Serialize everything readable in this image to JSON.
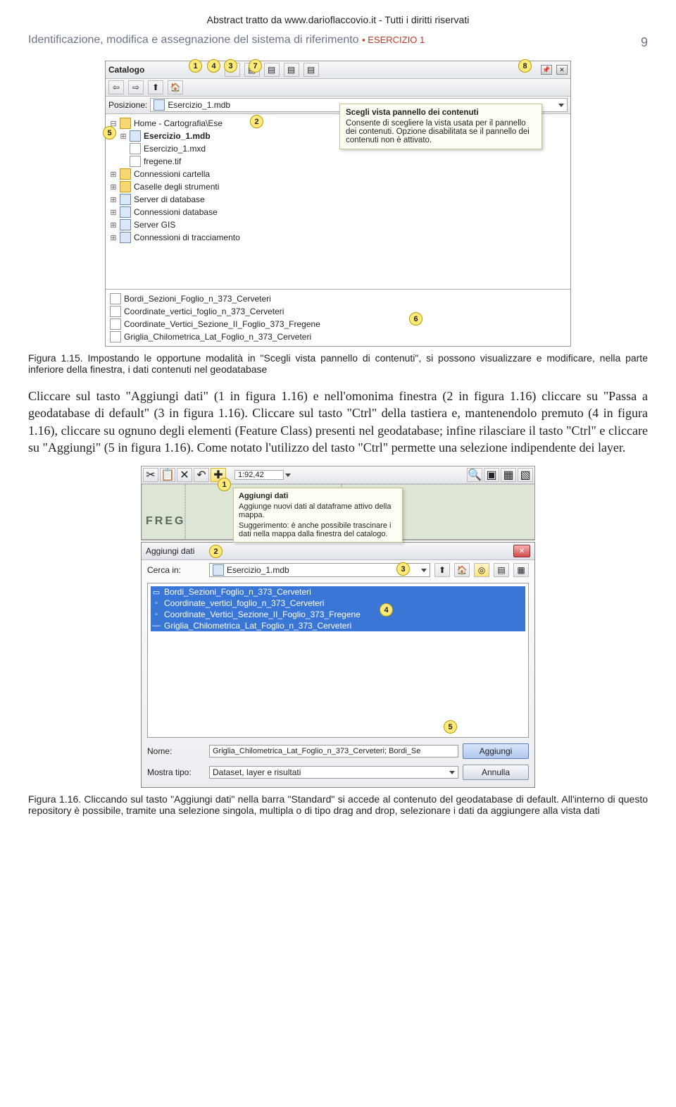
{
  "header": {
    "source_line": "Abstract tratto da www.darioflaccovio.it - Tutti i diritti riservati",
    "section": "Identificazione, modifica e assegnazione del sistema di riferimento",
    "exercise": "ESERCIZIO 1",
    "page_number": "9"
  },
  "screenshot1": {
    "title": "Catalogo",
    "position_label": "Posizione:",
    "position_value": "Esercizio_1.mdb",
    "tooltip_title": "Scegli vista pannello dei contenuti",
    "tooltip_body": "Consente di scegliere la vista usata per il pannello dei contenuti. Opzione disabilitata se il pannello dei contenuti non è attivato.",
    "tree": [
      "Home - Cartografia\\Ese",
      "Esercizio_1.mdb",
      "Esercizio_1.mxd",
      "fregene.tif",
      "Connessioni cartella",
      "Caselle degli strumenti",
      "Server di database",
      "Connessioni database",
      "Server GIS",
      "Connessioni di tracciamento"
    ],
    "list": [
      "Bordi_Sezioni_Foglio_n_373_Cerveteri",
      "Coordinate_vertici_foglio_n_373_Cerveteri",
      "Coordinate_Vertici_Sezione_II_Foglio_373_Fregene",
      "Griglia_Chilometrica_Lat_Foglio_n_373_Cerveteri"
    ],
    "bubbles": {
      "b1": "1",
      "b2": "2",
      "b3": "3",
      "b4": "4",
      "b5": "5",
      "b6": "6",
      "b7": "7",
      "b8": "8"
    }
  },
  "caption1": "Figura 1.15. Impostando le opportune modalità in \"Scegli vista pannello di contenuti\", si possono visualizzare e modificare, nella parte inferiore della finestra, i dati contenuti nel geodatabase",
  "paragraph": "Cliccare sul tasto \"Aggiungi dati\" (1 in figura 1.16) e nell'omonima finestra (2 in figura 1.16) cliccare su \"Passa a geodatabase di default\" (3 in figura 1.16). Cliccare sul tasto \"Ctrl\" della tastiera e, mantenendolo premuto (4 in figura 1.16), cliccare su ognuno degli elementi (Feature Class) presenti nel geodatabase; infine rilasciare il tasto \"Ctrl\" e cliccare su \"Aggiungi\" (5 in figura 1.16). Come notato l'utilizzo del tasto \"Ctrl\" permette una selezione indipendente dei layer.",
  "screenshot2": {
    "scale": "1:92,42",
    "map_label": "FREG",
    "tooltip_title": "Aggiungi dati",
    "tooltip_line1": "Aggiunge nuovi dati al dataframe attivo della mappa.",
    "tooltip_line2": "Suggerimento: è anche possibile trascinare i dati nella mappa dalla finestra del catalogo.",
    "dialog_title": "Aggiungi dati",
    "search_label": "Cerca in:",
    "search_value": "Esercizio_1.mdb",
    "files": [
      "Bordi_Sezioni_Foglio_n_373_Cerveteri",
      "Coordinate_vertici_foglio_n_373_Cerveteri",
      "Coordinate_Vertici_Sezione_II_Foglio_373_Fregene",
      "Griglia_Chilometrica_Lat_Foglio_n_373_Cerveteri"
    ],
    "name_label": "Nome:",
    "name_value": "Griglia_Chilometrica_Lat_Foglio_n_373_Cerveteri; Bordi_Se",
    "showtype_label": "Mostra tipo:",
    "showtype_value": "Dataset, layer e risultati",
    "add_button": "Aggiungi",
    "cancel_button": "Annulla",
    "bubbles": {
      "b1": "1",
      "b2": "2",
      "b3": "3",
      "b4": "4",
      "b5": "5"
    }
  },
  "caption2": "Figura 1.16. Cliccando sul tasto \"Aggiungi dati\" nella barra \"Standard\" si accede al contenuto del geodatabase di default. All'interno di questo repository è possibile, tramite una selezione singola, multipla o di tipo drag and drop, selezionare i dati da aggiungere alla vista dati"
}
